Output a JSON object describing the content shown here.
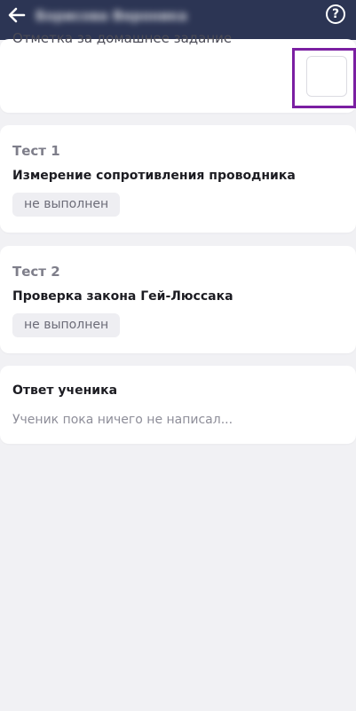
{
  "header": {
    "title": "Борисова Вероника",
    "back_icon": "arrow-left-icon",
    "help_label": "?",
    "background": "#2c3554"
  },
  "grade": {
    "label": "Отметка за домашнее задание",
    "value": "",
    "highlight_color": "#7b1fa2"
  },
  "tests": [
    {
      "number": "Тест 1",
      "name": "Измерение сопротивления проводника",
      "status": "не выполнен"
    },
    {
      "number": "Тест 2",
      "name": "Проверка закона Гей-Люссака",
      "status": "не выполнен"
    }
  ],
  "answer": {
    "title": "Ответ ученика",
    "text": "Ученик пока ничего не написал..."
  }
}
